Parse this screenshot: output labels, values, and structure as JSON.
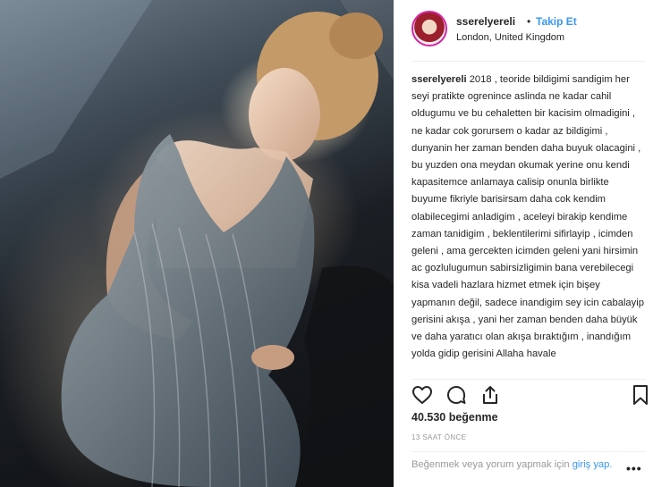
{
  "post": {
    "username": "sserelyereli",
    "separator": "•",
    "follow_label": "Takip Et",
    "location": "London, United Kingdom",
    "caption_user": "sserelyereli",
    "caption_text": "2018 , teoride bildigimi sandigim her seyi pratikte ogrenince aslinda ne kadar cahil oldugumu ve bu cehaletten bir kacisim olmadigini , ne kadar cok gorursem o kadar az bildigimi , dunyanin her zaman benden daha buyuk olacagini , bu yuzden ona meydan okumak yerine onu kendi kapasitemce anlamaya calisip onunla birlikte buyume fikriyle barisirsam daha cok kendim olabilecegimi anladigim , aceleyi birakip kendime zaman tanidigim , beklentilerimi sifirlayip , icimden geleni , ama gercekten icimden geleni yani hirsimin ac gozlulugumun sabirsizligimin bana verebilecegi kisa vadeli hazlara hizmet etmek için bişey yapmanın değil, sadece inandigim sey icin cabalayip gerisini akışa , yani her zaman benden daha büyük ve daha yaratıcı olan akışa bıraktığım , inandığım yolda gidip gerisini Allaha havale",
    "likes": "40.530 beğenme",
    "timestamp": "13 SAAT ÖNCE",
    "login_prompt": "Beğenmek veya yorum yapmak için",
    "login_link": "giriş yap.",
    "more_label": "•••",
    "icons": {
      "like": "heart-icon",
      "comment": "comment-icon",
      "share": "share-icon",
      "save": "bookmark-icon"
    },
    "colors": {
      "accent": "#3897f0",
      "text": "#262626",
      "muted": "#999999",
      "divider": "#efefef"
    }
  }
}
